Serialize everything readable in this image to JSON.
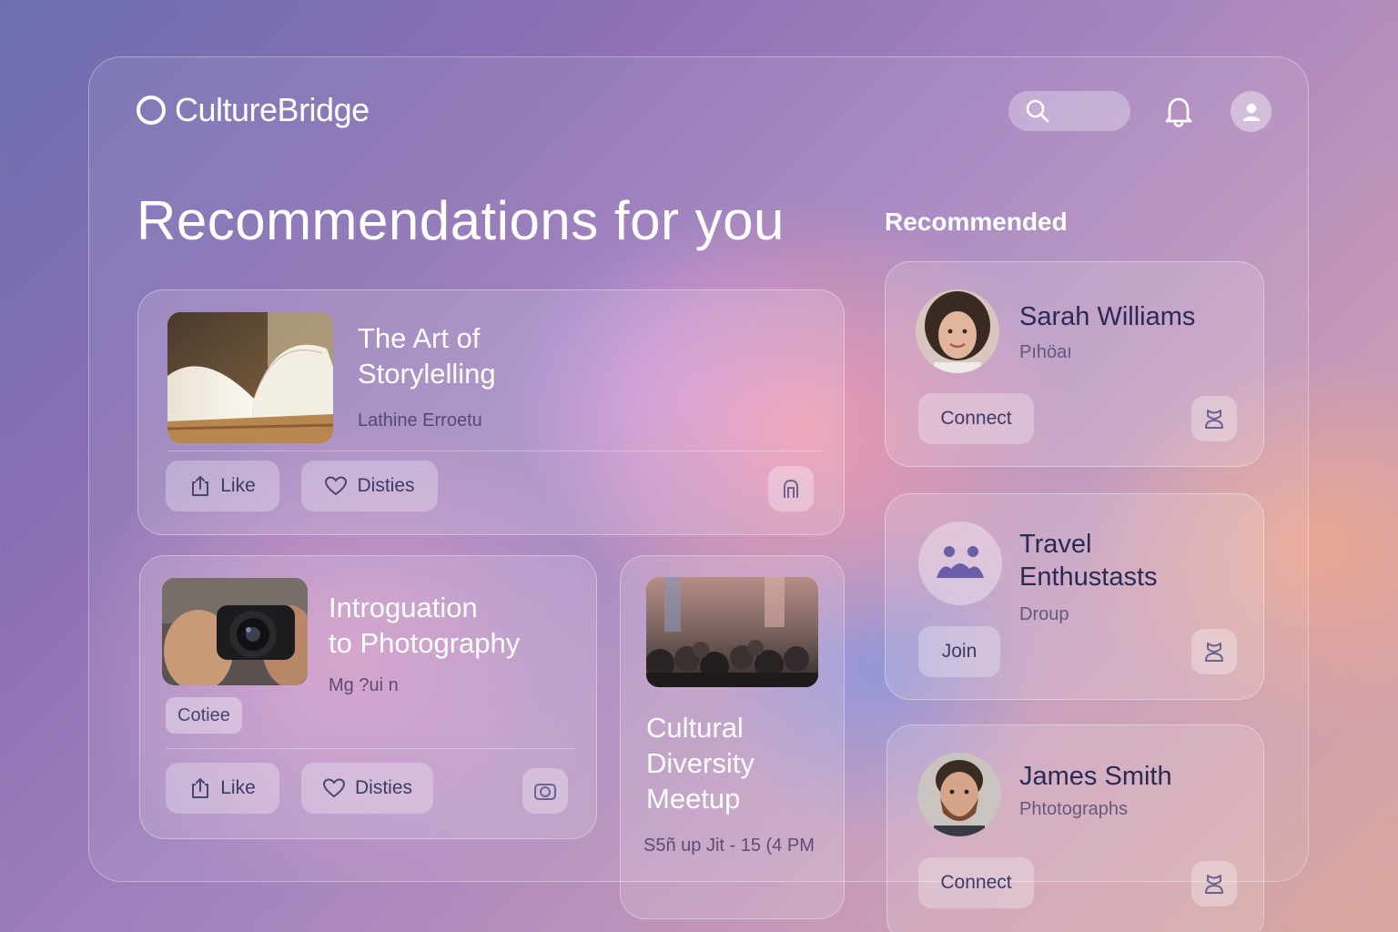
{
  "app": {
    "name": "CultureBridge"
  },
  "header": {
    "search_placeholder": ""
  },
  "page_title": "Recommendations for you",
  "sidebar_title": "Recommended",
  "cards": [
    {
      "title_line1": "The Art of",
      "title_line2": "Storylelling",
      "subtitle": "Lathine Erroetu",
      "like_label": "Like",
      "second_label": "Disties"
    },
    {
      "title_line1": "Introguation",
      "title_line2": "to Photography",
      "subtitle": "Mg ?ui n",
      "tag": "Cotiee",
      "like_label": "Like",
      "second_label": "Disties"
    },
    {
      "title_line1": "Cultural",
      "title_line2": "Diversity",
      "title_line3": "Meetup",
      "subtitle": "S5ñ up Jit - 15 (4 PM"
    }
  ],
  "recommended": [
    {
      "name": "Sarah Williams",
      "role": "Pıhöaı",
      "action": "Connect"
    },
    {
      "name_line1": "Travel",
      "name_line2": "Enthustasts",
      "role": "Droup",
      "action": "Join"
    },
    {
      "name": "James Smith",
      "role": "Phtotographs",
      "action": "Connect"
    }
  ],
  "colors": {
    "text_dark": "#2b2a55",
    "accent_white": "#ffffff"
  }
}
